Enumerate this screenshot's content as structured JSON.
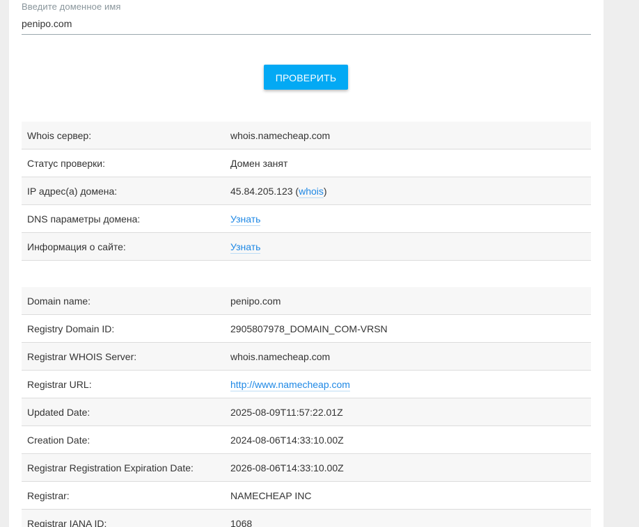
{
  "form": {
    "label": "Введите доменное имя",
    "value": "penipo.com",
    "submit_label": "ПРОВЕРИТЬ"
  },
  "summary": [
    {
      "key": "Whois сервер:",
      "value": "whois.namecheap.com"
    },
    {
      "key": "Статус проверки:",
      "value": "Домен занят"
    },
    {
      "key": "IP адрес(а) домена:",
      "ip": "45.84.205.123",
      "open": " (",
      "link": "whois",
      "close": ")"
    },
    {
      "key": "DNS параметры домена:",
      "link": "Узнать"
    },
    {
      "key": "Информация о сайте:",
      "link": "Узнать"
    }
  ],
  "whois": [
    {
      "key": "Domain name:",
      "value": "penipo.com"
    },
    {
      "key": "Registry Domain ID:",
      "value": "2905807978_DOMAIN_COM-VRSN"
    },
    {
      "key": "Registrar WHOIS Server:",
      "value": "whois.namecheap.com"
    },
    {
      "key": "Registrar URL:",
      "link": "http://www.namecheap.com"
    },
    {
      "key": "Updated Date:",
      "value": "2025-08-09T11:57:22.01Z"
    },
    {
      "key": "Creation Date:",
      "value": "2024-08-06T14:33:10.00Z"
    },
    {
      "key": "Registrar Registration Expiration Date:",
      "value": "2026-08-06T14:33:10.00Z"
    },
    {
      "key": "Registrar:",
      "value": "NAMECHEAP INC"
    },
    {
      "key": "Registrar IANA ID:",
      "value": "1068"
    }
  ],
  "colors": {
    "accent": "#03a9f4",
    "link": "#1e88e5",
    "row_alt": "#f7f7f7"
  }
}
